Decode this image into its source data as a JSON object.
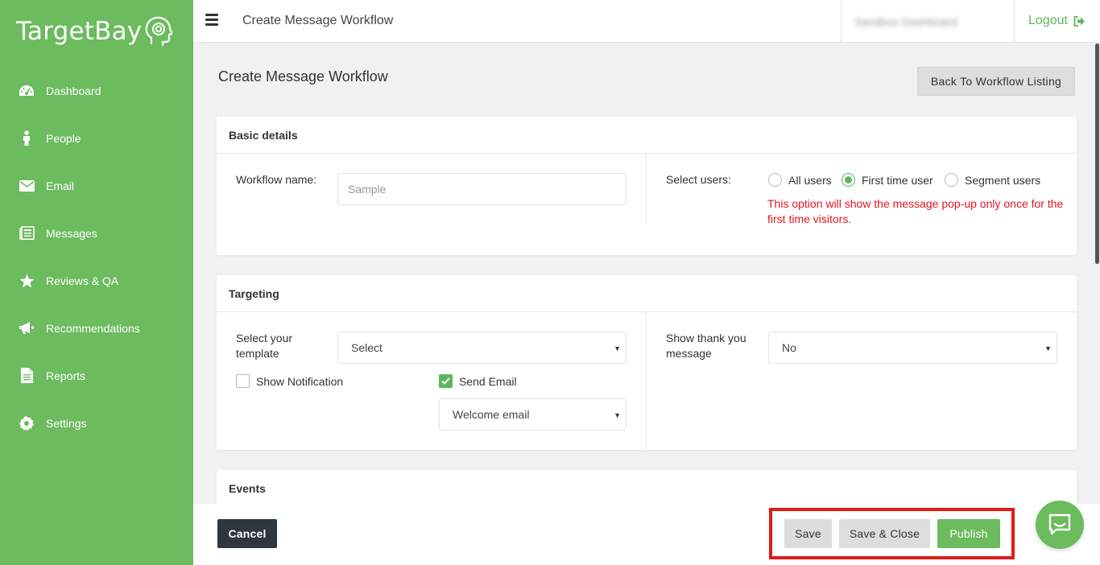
{
  "app": {
    "logo_text": "TargetBay"
  },
  "sidebar": {
    "items": [
      {
        "label": "Dashboard",
        "icon": "dashboard-icon"
      },
      {
        "label": "People",
        "icon": "person-icon"
      },
      {
        "label": "Email",
        "icon": "envelope-icon"
      },
      {
        "label": "Messages",
        "icon": "messages-icon"
      },
      {
        "label": "Reviews & QA",
        "icon": "star-icon"
      },
      {
        "label": "Recommendations",
        "icon": "megaphone-icon"
      },
      {
        "label": "Reports",
        "icon": "document-icon"
      },
      {
        "label": "Settings",
        "icon": "gear-icon"
      }
    ]
  },
  "header": {
    "title": "Create Message Workflow",
    "user_name": "Sandbox Dashboard",
    "logout_label": "Logout"
  },
  "main": {
    "title": "Create Message Workflow",
    "back_label": "Back To Workflow Listing",
    "basic": {
      "heading": "Basic details",
      "workflow_name_label": "Workflow name:",
      "workflow_name_placeholder": "Sample",
      "select_users_label": "Select users:",
      "user_options": [
        "All users",
        "First time user",
        "Segment users"
      ],
      "selected_user_option": "First time user",
      "note": "This option will show the message pop-up only once for the first time visitors."
    },
    "targeting": {
      "heading": "Targeting",
      "template_label": "Select your template",
      "template_value": "Select",
      "thank_label": "Show thank you message",
      "thank_value": "No",
      "show_notification_label": "Show Notification",
      "show_notification_checked": false,
      "send_email_label": "Send Email",
      "send_email_checked": true,
      "email_value": "Welcome email"
    },
    "events": {
      "heading": "Events"
    }
  },
  "footer": {
    "cancel_label": "Cancel",
    "save_label": "Save",
    "save_close_label": "Save & Close",
    "publish_label": "Publish"
  },
  "colors": {
    "brand_green": "#6cbb5e",
    "warning_red": "#e0151b",
    "highlight_red": "#e31a1a",
    "cancel_dark": "#2f3640"
  }
}
